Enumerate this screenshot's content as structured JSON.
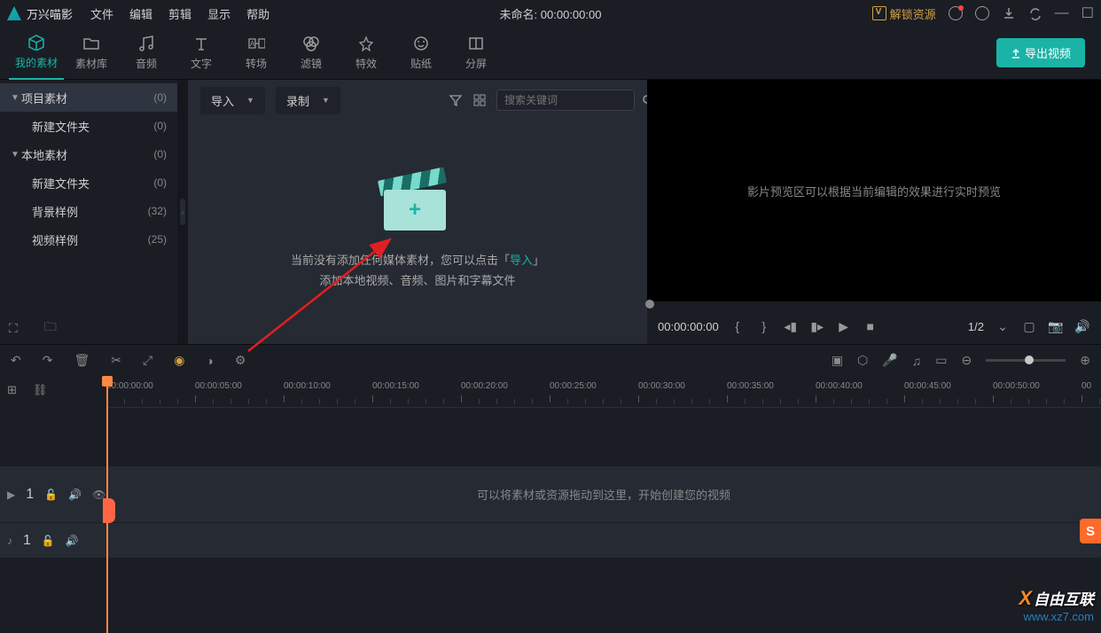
{
  "menubar": {
    "app_name": "万兴喵影",
    "menus": [
      "文件",
      "编辑",
      "剪辑",
      "显示",
      "帮助"
    ],
    "title_prefix": "未命名:",
    "title_time": "00:00:00:00",
    "unlock_label": "解锁资源"
  },
  "main_tabs": [
    {
      "label": "我的素材",
      "icon": "box"
    },
    {
      "label": "素材库",
      "icon": "folder"
    },
    {
      "label": "音频",
      "icon": "music"
    },
    {
      "label": "文字",
      "icon": "text"
    },
    {
      "label": "转场",
      "icon": "transition"
    },
    {
      "label": "滤镜",
      "icon": "filter"
    },
    {
      "label": "特效",
      "icon": "effect"
    },
    {
      "label": "贴纸",
      "icon": "sticker"
    },
    {
      "label": "分屏",
      "icon": "split"
    }
  ],
  "export_button": "导出视频",
  "sidebar": [
    {
      "label": "项目素材",
      "count": "(0)",
      "expandable": true,
      "selected": true
    },
    {
      "label": "新建文件夹",
      "count": "(0)",
      "child": true
    },
    {
      "label": "本地素材",
      "count": "(0)",
      "expandable": true
    },
    {
      "label": "新建文件夹",
      "count": "(0)",
      "child": true
    },
    {
      "label": "背景样例",
      "count": "(32)",
      "child": true
    },
    {
      "label": "视频样例",
      "count": "(25)",
      "child": true
    }
  ],
  "media_toolbar": {
    "import_label": "导入",
    "record_label": "录制",
    "search_placeholder": "搜索关键词"
  },
  "media_empty": {
    "line1_before": "当前没有添加任何媒体素材，您可以点击「",
    "line1_link": "导入",
    "line1_after": "」",
    "line2": "添加本地视频、音频、图片和字幕文件"
  },
  "preview": {
    "hint": "影片预览区可以根据当前编辑的效果进行实时预览",
    "time": "00:00:00:00",
    "ratio": "1/2"
  },
  "timeline": {
    "ticks": [
      "00:00:00:00",
      "00:00:05:00",
      "00:00:10:00",
      "00:00:15:00",
      "00:00:20:00",
      "00:00:25:00",
      "00:00:30:00",
      "00:00:35:00",
      "00:00:40:00",
      "00:00:45:00",
      "00:00:50:00",
      "00"
    ],
    "drop_hint": "可以将素材或资源拖动到这里，开始创建您的视频",
    "video_track_num": "1",
    "audio_track_num": "1"
  },
  "watermark": {
    "text": "自由互联",
    "url": "www.xz7.com"
  },
  "badge_letter": "S"
}
